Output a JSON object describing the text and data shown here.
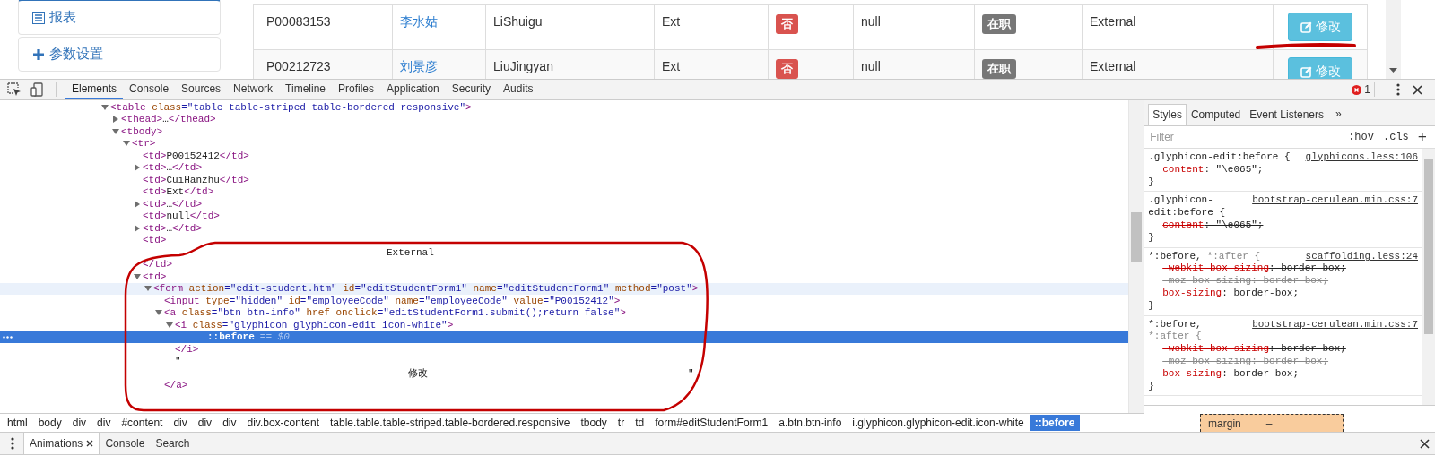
{
  "sidebar": {
    "items": [
      {
        "label": "报表",
        "selected": false
      },
      {
        "label": "参数设置",
        "selected": false
      }
    ]
  },
  "table": {
    "rows": [
      {
        "code": "P00083153",
        "name": "李水姑",
        "pinyin": "LiShuigu",
        "type": "Ext",
        "flag": "否",
        "value": "null",
        "status": "在职",
        "source": "External",
        "action": "修改"
      },
      {
        "code": "P00212723",
        "name": "刘景彦",
        "pinyin": "LiuJingyan",
        "type": "Ext",
        "flag": "否",
        "value": "null",
        "status": "在职",
        "source": "External",
        "action": "修改"
      }
    ]
  },
  "devtools": {
    "tabs": [
      {
        "label": "Elements",
        "selected": true
      },
      {
        "label": "Console",
        "selected": false
      },
      {
        "label": "Sources",
        "selected": false
      },
      {
        "label": "Network",
        "selected": false
      },
      {
        "label": "Timeline",
        "selected": false
      },
      {
        "label": "Profiles",
        "selected": false
      },
      {
        "label": "Application",
        "selected": false
      },
      {
        "label": "Security",
        "selected": false
      },
      {
        "label": "Audits",
        "selected": false
      }
    ],
    "error_count": "1",
    "dom": {
      "nodes": [
        {
          "text": "<table class=\"table table-striped table-bordered responsive\">",
          "expanded": true,
          "selected": false,
          "hovered": false,
          "children": [
            {
              "text": "<thead>…</thead>",
              "expanded": false,
              "selected": false,
              "hovered": false
            },
            {
              "text": "<tbody>",
              "expanded": true,
              "selected": false,
              "hovered": false,
              "children": [
                {
                  "text": "<tr>",
                  "expanded": true,
                  "selected": false,
                  "hovered": false,
                  "children": [
                    {
                      "text": "<td>P00152412</td>",
                      "selected": false,
                      "hovered": false
                    },
                    {
                      "text": "<td>…</td>",
                      "expanded": false,
                      "selected": false,
                      "hovered": false
                    },
                    {
                      "text": "<td>CuiHanzhu</td>",
                      "selected": false,
                      "hovered": false
                    },
                    {
                      "text": "<td>Ext</td>",
                      "selected": false,
                      "hovered": false
                    },
                    {
                      "text": "<td>…</td>",
                      "expanded": false,
                      "selected": false,
                      "hovered": false
                    },
                    {
                      "text": "<td>null</td>",
                      "selected": false,
                      "hovered": false
                    },
                    {
                      "text": "<td>…</td>",
                      "expanded": false,
                      "selected": false,
                      "hovered": false
                    },
                    {
                      "text": "<td>",
                      "selected": false,
                      "hovered": false,
                      "close": "</td>",
                      "children": [
                        {
                          "kind": "text",
                          "parts": [
                            "External"
                          ],
                          "selected": false,
                          "hovered": false
                        }
                      ]
                    },
                    {
                      "text": "<td>",
                      "expanded": true,
                      "selected": false,
                      "hovered": false,
                      "children": [
                        {
                          "text": "<form action=\"edit-student.htm\" id=\"editStudentForm1\" name=\"editStudentForm1\" method=\"post\">",
                          "expanded": true,
                          "selected": false,
                          "hovered": true,
                          "children": [
                            {
                              "text": "<input type=\"hidden\" id=\"employeeCode\" name=\"employeeCode\" value=\"P00152412\">",
                              "selected": false,
                              "hovered": false
                            },
                            {
                              "text": "<a class=\"btn btn-info\" href onclick=\"editStudentForm1.submit();return false\">",
                              "expanded": true,
                              "selected": false,
                              "hovered": false,
                              "close": "</a>",
                              "children": [
                                {
                                  "text": "<i class=\"glyphicon glyphicon-edit icon-white\">",
                                  "expanded": true,
                                  "selected": false,
                                  "hovered": false,
                                  "close": "</i>",
                                  "children": [
                                    {
                                      "kind": "pseudo",
                                      "text": "::before",
                                      "suffix": "== $0",
                                      "selected": true,
                                      "hovered": false
                                    }
                                  ]
                                },
                                {
                                  "kind": "text-start",
                                  "parts": [
                                    "\""
                                  ],
                                  "selected": false,
                                  "hovered": false
                                },
                                {
                                  "kind": "text",
                                  "parts": [
                                    "修改",
                                    "\""
                                  ],
                                  "selected": false,
                                  "hovered": false
                                }
                              ]
                            }
                          ]
                        }
                      ]
                    }
                  ]
                }
              ]
            }
          ]
        }
      ]
    },
    "breadcrumbs": [
      {
        "label": "html",
        "selected": false
      },
      {
        "label": "body",
        "selected": false
      },
      {
        "label": "div",
        "selected": false
      },
      {
        "label": "div",
        "selected": false
      },
      {
        "label": "#content",
        "selected": false
      },
      {
        "label": "div",
        "selected": false
      },
      {
        "label": "div",
        "selected": false
      },
      {
        "label": "div",
        "selected": false
      },
      {
        "label": "div.box-content",
        "selected": false
      },
      {
        "label": "table.table.table-striped.table-bordered.responsive",
        "selected": false
      },
      {
        "label": "tbody",
        "selected": false
      },
      {
        "label": "tr",
        "selected": false
      },
      {
        "label": "td",
        "selected": false
      },
      {
        "label": "form#editStudentForm1",
        "selected": false
      },
      {
        "label": "a.btn.btn-info",
        "selected": false
      },
      {
        "label": "i.glyphicon.glyphicon-edit.icon-white",
        "selected": false
      },
      {
        "label": "::before",
        "selected": true
      }
    ],
    "styles": {
      "tabs": [
        {
          "label": "Styles",
          "selected": true
        },
        {
          "label": "Computed",
          "selected": false
        },
        {
          "label": "Event Listeners",
          "selected": false
        }
      ],
      "more": "»",
      "filter": {
        "placeholder": "Filter"
      },
      "hov": ":hov",
      "cls": ".cls",
      "add": "+",
      "rules": [
        {
          "selectors": [
            {
              "text": ".glyphicon-edit:before {",
              "matched": true
            }
          ],
          "source": "glyphicons.less:106",
          "close": "}",
          "declarations": [
            {
              "name": "content",
              "value": ": \"\\e065\";",
              "overridden": false,
              "valid": true
            }
          ]
        },
        {
          "selectors": [
            {
              "text": ".glyphicon-edit:before {",
              "matched": true
            }
          ],
          "source": "bootstrap-cerulean.min.css:7",
          "close": "}",
          "declarations": [
            {
              "name": "content",
              "value": ": \"\\e065\";",
              "overridden": true,
              "valid": true
            }
          ]
        },
        {
          "selectors": [
            {
              "text": "*:before,",
              "matched": true
            },
            {
              "text": "*:after {",
              "matched": false
            }
          ],
          "source": "scaffolding.less:24",
          "close": "}",
          "declarations": [
            {
              "name": "-webkit-box-sizing",
              "value": ": border-box;",
              "overridden": true,
              "valid": true
            },
            {
              "name": "-moz-box-sizing",
              "value": ": border-box;",
              "overridden": true,
              "valid": false
            },
            {
              "name": "box-sizing",
              "value": ": border-box;",
              "overridden": false,
              "valid": true
            }
          ]
        },
        {
          "selectors": [
            {
              "text": "*:before,",
              "matched": true
            },
            {
              "text": "*:after {",
              "matched": false
            }
          ],
          "source": "bootstrap-cerulean.min.css:7",
          "close": "}",
          "declarations": [
            {
              "name": "-webkit-box-sizing",
              "value": ": border-box;",
              "overridden": true,
              "valid": true
            },
            {
              "name": "-moz-box-sizing",
              "value": ": border-box;",
              "overridden": true,
              "valid": false
            },
            {
              "name": "box-sizing",
              "value": ": border-box;",
              "overridden": true,
              "valid": true
            }
          ]
        }
      ],
      "box_model": {
        "label": "margin",
        "value": "–"
      }
    },
    "drawer": {
      "tabs": [
        {
          "label": "Animations",
          "selected": true,
          "closable": true
        },
        {
          "label": "Console",
          "selected": false,
          "closable": false
        },
        {
          "label": "Search",
          "selected": false,
          "closable": false
        }
      ]
    }
  }
}
